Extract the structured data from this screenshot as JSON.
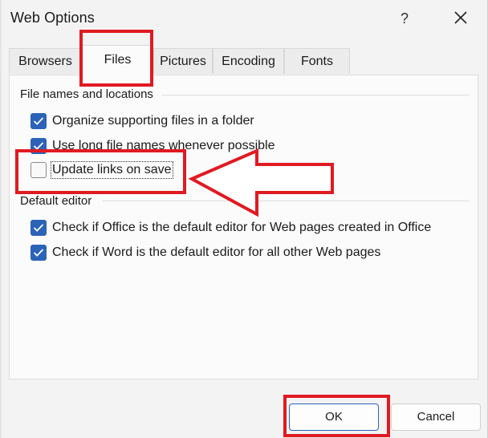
{
  "window": {
    "title": "Web Options",
    "help_label": "?"
  },
  "tabs": [
    {
      "label": "Browsers",
      "active": false
    },
    {
      "label": "Files",
      "active": true
    },
    {
      "label": "Pictures",
      "active": false
    },
    {
      "label": "Encoding",
      "active": false
    },
    {
      "label": "Fonts",
      "active": false
    }
  ],
  "groups": {
    "file_names": {
      "label": "File names and locations",
      "options": [
        {
          "label": "Organize supporting files in a folder",
          "checked": true
        },
        {
          "label": "Use long file names whenever possible",
          "checked": true
        },
        {
          "label": "Update links on save",
          "checked": false
        }
      ]
    },
    "default_editor": {
      "label": "Default editor",
      "options": [
        {
          "label": "Check if Office is the default editor for Web pages created in Office",
          "checked": true
        },
        {
          "label": "Check if Word is the default editor for all other Web pages",
          "checked": true
        }
      ]
    }
  },
  "buttons": {
    "ok": "OK",
    "cancel": "Cancel"
  },
  "colors": {
    "accent": "#2b63b8",
    "annotation": "#e01a22"
  },
  "icons": {
    "close": "close-icon",
    "check": "checkmark-icon",
    "annotation_arrow": "left-arrow-icon"
  }
}
